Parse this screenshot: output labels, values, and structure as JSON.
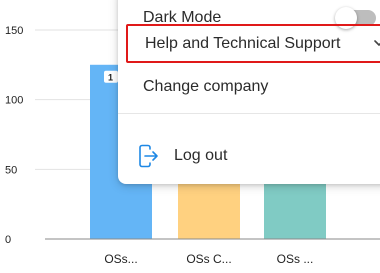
{
  "menu": {
    "dark_mode_label": "Dark Mode",
    "dark_mode_enabled": false,
    "help_label": "Help and Technical Support",
    "change_company_label": "Change company",
    "logout_label": "Log out",
    "icons": {
      "logout": "logout-icon",
      "help_expand": "chevron-down-icon"
    }
  },
  "chart_data": {
    "type": "bar",
    "categories": [
      "OSs...",
      "OSs C...",
      "OSs ..."
    ],
    "values": [
      125,
      85,
      85
    ],
    "value_labels": [
      "1",
      "",
      ""
    ],
    "yticks": [
      0,
      50,
      100,
      150
    ],
    "ylim": [
      0,
      160
    ],
    "grid": true,
    "colors": [
      "#64b5f6",
      "#ffd180",
      "#80cbc4"
    ],
    "title": "",
    "xlabel": "",
    "ylabel": ""
  },
  "colors": {
    "highlight_border": "#e01919",
    "toggle_track": "#bdbdbd",
    "icon_blue": "#1e88e5"
  }
}
